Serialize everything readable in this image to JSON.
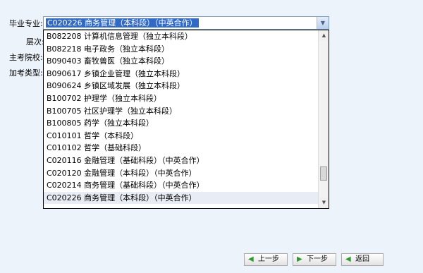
{
  "form": {
    "major_label": "毕业专业:",
    "level_label": "层次:",
    "school_label": "主考院校:",
    "type_label": "加考类型:"
  },
  "major_select": {
    "selected_value": "C020226 商务管理（本科段）（中英合作）",
    "arrow_icon": "chevron-down-icon",
    "options": [
      "B082208 计算机信息管理（独立本科段）",
      "B082218 电子政务（独立本科段）",
      "B090403 畜牧兽医（独立本科段）",
      "B090617 乡镇企业管理（独立本科段）",
      "B090624 乡镇区域发展（独立本科段）",
      "B100702 护理学（独立本科段）",
      "B100705 社区护理学（独立本科段）",
      "B100805 药学（独立本科段）",
      "C010101 哲学（本科段）",
      "C010102 哲学（基础科段）",
      "C020116 金融管理（基础科段）（中英合作）",
      "C020120 金融管理（本科段）（中英合作）",
      "C020214 商务管理（基础科段）（中英合作）",
      "C020226 商务管理（本科段）（中英合作）"
    ]
  },
  "buttons": {
    "prev": "上一步",
    "next": "下一步",
    "back": "返回"
  },
  "colors": {
    "selection": "#316ac5",
    "background": "#ecf3fb",
    "arrow": "#2e9b2e"
  }
}
